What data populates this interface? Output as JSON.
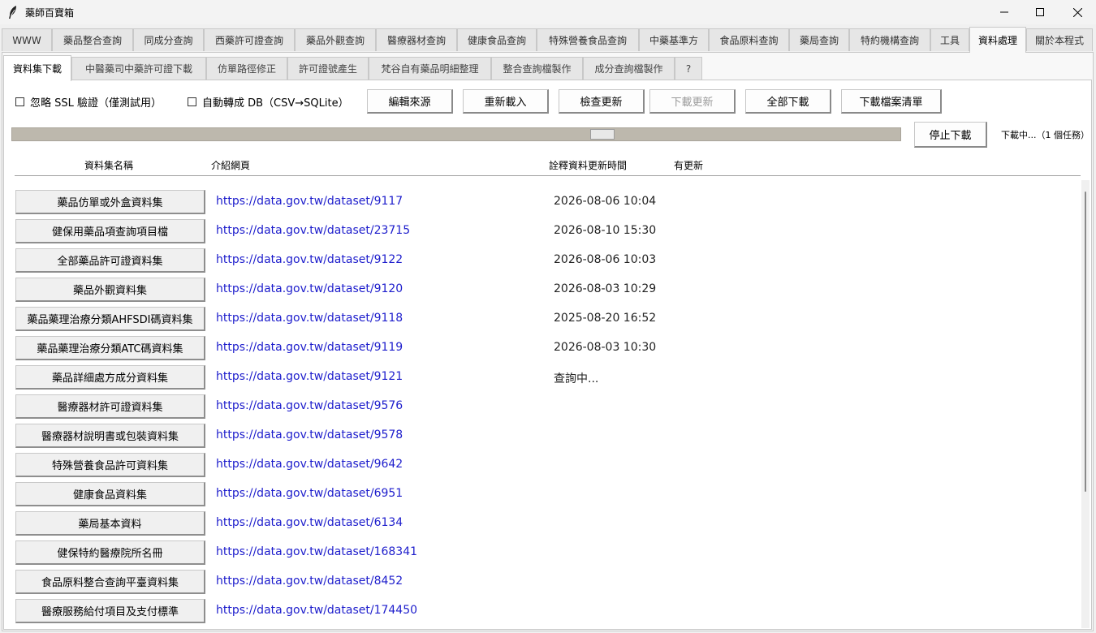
{
  "window": {
    "title": "藥師百寶箱",
    "icon": "feather-icon"
  },
  "main_tabs": [
    {
      "label": "WWW"
    },
    {
      "label": "藥品整合查詢"
    },
    {
      "label": "同成分查詢"
    },
    {
      "label": "西藥許可證查詢"
    },
    {
      "label": "藥品外觀查詢"
    },
    {
      "label": "醫療器材查詢"
    },
    {
      "label": "健康食品查詢"
    },
    {
      "label": "特殊營養食品查詢"
    },
    {
      "label": "中藥基準方"
    },
    {
      "label": "食品原料查詢"
    },
    {
      "label": "藥局查詢"
    },
    {
      "label": "特約機構查詢"
    },
    {
      "label": "工具"
    },
    {
      "label": "資料處理",
      "active": true
    },
    {
      "label": "關於本程式"
    }
  ],
  "sub_tabs": [
    {
      "label": "資料集下載",
      "active": true
    },
    {
      "label": "中醫藥司中藥許可證下載"
    },
    {
      "label": "仿單路徑修正"
    },
    {
      "label": "許可證號產生"
    },
    {
      "label": "梵谷自有藥品明細整理"
    },
    {
      "label": "整合查詢檔製作"
    },
    {
      "label": "成分查詢檔製作"
    },
    {
      "label": "?"
    }
  ],
  "toolbar": {
    "ignore_ssl_label": "忽略 SSL 驗證（僅測試用）",
    "ignore_ssl_checked": false,
    "auto_db_label": "自動轉成 DB（CSV→SQLite）",
    "auto_db_checked": false,
    "edit_source": "編輯來源",
    "reload": "重新載入",
    "check_update": "檢查更新",
    "download_update": "下載更新",
    "download_all": "全部下載",
    "download_list": "下載檔案清單"
  },
  "progress": {
    "indeterminate": true
  },
  "stop_button": "停止下載",
  "status_text": "下載中...（1 個任務）",
  "columns": {
    "name": "資料集名稱",
    "page": "介紹網頁",
    "updated": "詮釋資料更新時間",
    "has_update": "有更新"
  },
  "datasets": [
    {
      "name": "藥品仿單或外盒資料集",
      "url": "https://data.gov.tw/dataset/9117",
      "updated": "2026-08-06 10:04",
      "has_update": ""
    },
    {
      "name": "健保用藥品項查詢項目檔",
      "url": "https://data.gov.tw/dataset/23715",
      "updated": "2026-08-10 15:30",
      "has_update": ""
    },
    {
      "name": "全部藥品許可證資料集",
      "url": "https://data.gov.tw/dataset/9122",
      "updated": "2026-08-06 10:03",
      "has_update": ""
    },
    {
      "name": "藥品外觀資料集",
      "url": "https://data.gov.tw/dataset/9120",
      "updated": "2026-08-03 10:29",
      "has_update": ""
    },
    {
      "name": "藥品藥理治療分類AHFSDI碼資料集",
      "url": "https://data.gov.tw/dataset/9118",
      "updated": "2025-08-20 16:52",
      "has_update": ""
    },
    {
      "name": "藥品藥理治療分類ATC碼資料集",
      "url": "https://data.gov.tw/dataset/9119",
      "updated": "2026-08-03 10:30",
      "has_update": ""
    },
    {
      "name": "藥品詳細處方成分資料集",
      "url": "https://data.gov.tw/dataset/9121",
      "updated": "查詢中...",
      "has_update": ""
    },
    {
      "name": "醫療器材許可證資料集",
      "url": "https://data.gov.tw/dataset/9576",
      "updated": "",
      "has_update": ""
    },
    {
      "name": "醫療器材說明書或包裝資料集",
      "url": "https://data.gov.tw/dataset/9578",
      "updated": "",
      "has_update": ""
    },
    {
      "name": "特殊營養食品許可資料集",
      "url": "https://data.gov.tw/dataset/9642",
      "updated": "",
      "has_update": ""
    },
    {
      "name": "健康食品資料集",
      "url": "https://data.gov.tw/dataset/6951",
      "updated": "",
      "has_update": ""
    },
    {
      "name": "藥局基本資料",
      "url": "https://data.gov.tw/dataset/6134",
      "updated": "",
      "has_update": ""
    },
    {
      "name": "健保特約醫療院所名冊",
      "url": "https://data.gov.tw/dataset/168341",
      "updated": "",
      "has_update": ""
    },
    {
      "name": "食品原料整合查詢平臺資料集",
      "url": "https://data.gov.tw/dataset/8452",
      "updated": "",
      "has_update": ""
    },
    {
      "name": "醫療服務給付項目及支付標準",
      "url": "https://data.gov.tw/dataset/174450",
      "updated": "",
      "has_update": ""
    }
  ]
}
